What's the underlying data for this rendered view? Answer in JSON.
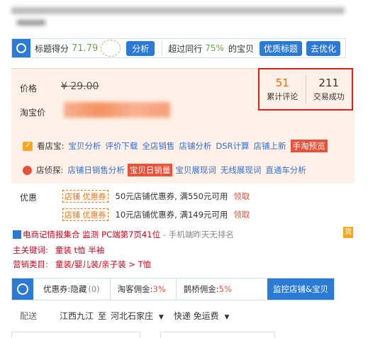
{
  "title_blur": "",
  "score_bar": {
    "title_score_label": "标题得分",
    "title_score_value": "71.79",
    "analyze_btn": "分析",
    "surpass_prefix": "超过同行",
    "surpass_pct": "75%",
    "surpass_suffix": "的宝贝",
    "optimize_title_btn": "优质标题",
    "go_optimize_btn": "去优化"
  },
  "price": {
    "label": "价格",
    "old_price": "¥ 29.00",
    "taobao_label": "淘宝价"
  },
  "stats": {
    "reviews_value": "51",
    "reviews_label": "累计评论",
    "deals_value": "211",
    "deals_label": "交易成功"
  },
  "kandianbao": {
    "label": "看店宝:",
    "links": [
      "宝贝分析",
      "评价下载",
      "全店销售",
      "店铺分析",
      "DSR计算",
      "店铺上新"
    ],
    "highlight": "手淘预览"
  },
  "dianzhentan": {
    "label": "店侦探:",
    "links_before": [
      "店铺日销售分析"
    ],
    "highlight": "宝贝日销量",
    "links_after": [
      "宝贝展现词",
      "无线展现词",
      "直通车分析"
    ]
  },
  "coupons": {
    "label": "优惠",
    "items": [
      {
        "tag": "店铺  优惠券",
        "desc": "50元店铺优惠券, 满550元可用",
        "claim": "领取"
      },
      {
        "tag": "店铺  优惠券",
        "desc": "10元店铺优惠券, 满149元可用",
        "claim": "领取"
      }
    ]
  },
  "intel": {
    "head": "电商记情报集合 监测",
    "rank": "PC端第7页41位",
    "note": "- 手机端昨天无排名",
    "badge": "货"
  },
  "keywords": {
    "label": "主关键词:",
    "values": "童装 t恤 半袖"
  },
  "category": {
    "label": "营销类目:",
    "values": "童装/婴儿装/亲子装 > T恤"
  },
  "bottom_bar": {
    "coupon_label": "优惠券:隐藏",
    "coupon_count": "(0)",
    "taoke_label": "淘客佣金:",
    "taoke_pct": "3%",
    "queqiao_label": "鹊桥佣金:",
    "queqiao_pct": "5%",
    "monitor_btn": "监控店铺&宝贝"
  },
  "shipping": {
    "label": "配送",
    "from": "江西九江",
    "to_word": "至",
    "to": "河北石家庄",
    "method": "快递 免运费"
  },
  "colors": {
    "accent_blue": "#2b7ad6",
    "orange": "#f60",
    "red_box": "#e02020",
    "price_bg": "#fff1e8"
  }
}
